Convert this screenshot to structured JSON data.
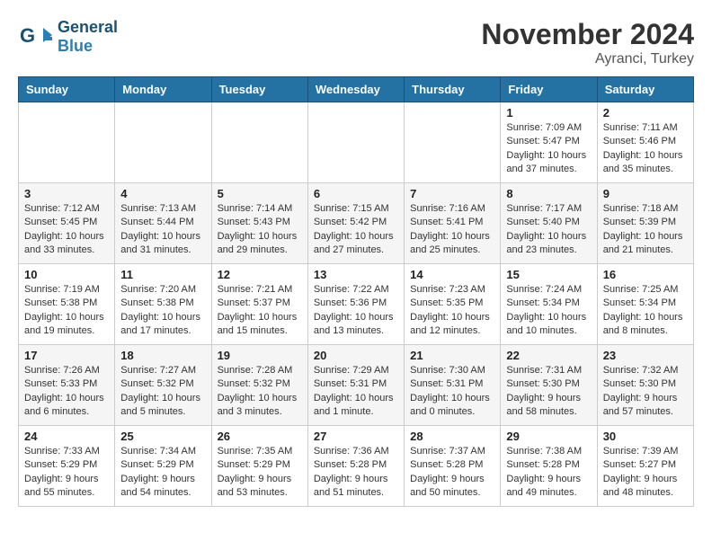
{
  "header": {
    "logo_general": "General",
    "logo_blue": "Blue",
    "month_title": "November 2024",
    "location": "Ayranci, Turkey"
  },
  "weekdays": [
    "Sunday",
    "Monday",
    "Tuesday",
    "Wednesday",
    "Thursday",
    "Friday",
    "Saturday"
  ],
  "weeks": [
    [
      {
        "day": "",
        "info": ""
      },
      {
        "day": "",
        "info": ""
      },
      {
        "day": "",
        "info": ""
      },
      {
        "day": "",
        "info": ""
      },
      {
        "day": "",
        "info": ""
      },
      {
        "day": "1",
        "info": "Sunrise: 7:09 AM\nSunset: 5:47 PM\nDaylight: 10 hours and 37 minutes."
      },
      {
        "day": "2",
        "info": "Sunrise: 7:11 AM\nSunset: 5:46 PM\nDaylight: 10 hours and 35 minutes."
      }
    ],
    [
      {
        "day": "3",
        "info": "Sunrise: 7:12 AM\nSunset: 5:45 PM\nDaylight: 10 hours and 33 minutes."
      },
      {
        "day": "4",
        "info": "Sunrise: 7:13 AM\nSunset: 5:44 PM\nDaylight: 10 hours and 31 minutes."
      },
      {
        "day": "5",
        "info": "Sunrise: 7:14 AM\nSunset: 5:43 PM\nDaylight: 10 hours and 29 minutes."
      },
      {
        "day": "6",
        "info": "Sunrise: 7:15 AM\nSunset: 5:42 PM\nDaylight: 10 hours and 27 minutes."
      },
      {
        "day": "7",
        "info": "Sunrise: 7:16 AM\nSunset: 5:41 PM\nDaylight: 10 hours and 25 minutes."
      },
      {
        "day": "8",
        "info": "Sunrise: 7:17 AM\nSunset: 5:40 PM\nDaylight: 10 hours and 23 minutes."
      },
      {
        "day": "9",
        "info": "Sunrise: 7:18 AM\nSunset: 5:39 PM\nDaylight: 10 hours and 21 minutes."
      }
    ],
    [
      {
        "day": "10",
        "info": "Sunrise: 7:19 AM\nSunset: 5:38 PM\nDaylight: 10 hours and 19 minutes."
      },
      {
        "day": "11",
        "info": "Sunrise: 7:20 AM\nSunset: 5:38 PM\nDaylight: 10 hours and 17 minutes."
      },
      {
        "day": "12",
        "info": "Sunrise: 7:21 AM\nSunset: 5:37 PM\nDaylight: 10 hours and 15 minutes."
      },
      {
        "day": "13",
        "info": "Sunrise: 7:22 AM\nSunset: 5:36 PM\nDaylight: 10 hours and 13 minutes."
      },
      {
        "day": "14",
        "info": "Sunrise: 7:23 AM\nSunset: 5:35 PM\nDaylight: 10 hours and 12 minutes."
      },
      {
        "day": "15",
        "info": "Sunrise: 7:24 AM\nSunset: 5:34 PM\nDaylight: 10 hours and 10 minutes."
      },
      {
        "day": "16",
        "info": "Sunrise: 7:25 AM\nSunset: 5:34 PM\nDaylight: 10 hours and 8 minutes."
      }
    ],
    [
      {
        "day": "17",
        "info": "Sunrise: 7:26 AM\nSunset: 5:33 PM\nDaylight: 10 hours and 6 minutes."
      },
      {
        "day": "18",
        "info": "Sunrise: 7:27 AM\nSunset: 5:32 PM\nDaylight: 10 hours and 5 minutes."
      },
      {
        "day": "19",
        "info": "Sunrise: 7:28 AM\nSunset: 5:32 PM\nDaylight: 10 hours and 3 minutes."
      },
      {
        "day": "20",
        "info": "Sunrise: 7:29 AM\nSunset: 5:31 PM\nDaylight: 10 hours and 1 minute."
      },
      {
        "day": "21",
        "info": "Sunrise: 7:30 AM\nSunset: 5:31 PM\nDaylight: 10 hours and 0 minutes."
      },
      {
        "day": "22",
        "info": "Sunrise: 7:31 AM\nSunset: 5:30 PM\nDaylight: 9 hours and 58 minutes."
      },
      {
        "day": "23",
        "info": "Sunrise: 7:32 AM\nSunset: 5:30 PM\nDaylight: 9 hours and 57 minutes."
      }
    ],
    [
      {
        "day": "24",
        "info": "Sunrise: 7:33 AM\nSunset: 5:29 PM\nDaylight: 9 hours and 55 minutes."
      },
      {
        "day": "25",
        "info": "Sunrise: 7:34 AM\nSunset: 5:29 PM\nDaylight: 9 hours and 54 minutes."
      },
      {
        "day": "26",
        "info": "Sunrise: 7:35 AM\nSunset: 5:29 PM\nDaylight: 9 hours and 53 minutes."
      },
      {
        "day": "27",
        "info": "Sunrise: 7:36 AM\nSunset: 5:28 PM\nDaylight: 9 hours and 51 minutes."
      },
      {
        "day": "28",
        "info": "Sunrise: 7:37 AM\nSunset: 5:28 PM\nDaylight: 9 hours and 50 minutes."
      },
      {
        "day": "29",
        "info": "Sunrise: 7:38 AM\nSunset: 5:28 PM\nDaylight: 9 hours and 49 minutes."
      },
      {
        "day": "30",
        "info": "Sunrise: 7:39 AM\nSunset: 5:27 PM\nDaylight: 9 hours and 48 minutes."
      }
    ]
  ]
}
